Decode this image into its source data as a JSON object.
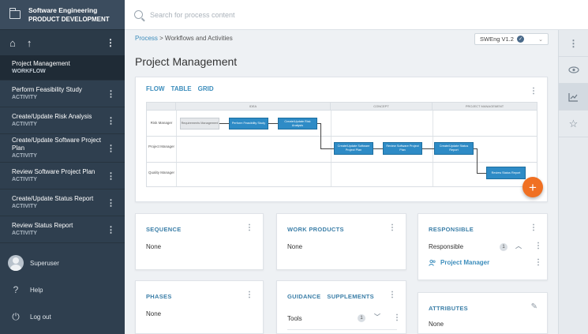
{
  "sidebar": {
    "header": {
      "line1": "Software Engineering",
      "line2": "PRODUCT DEVELOPMENT"
    },
    "current": {
      "name": "Project Management",
      "type": "WORKFLOW"
    },
    "items": [
      {
        "name": "Perform Feasibility Study",
        "type": "ACTIVITY"
      },
      {
        "name": "Create/Update Risk Analysis",
        "type": "ACTIVITY"
      },
      {
        "name": "Create/Update Software Project Plan",
        "type": "ACTIVITY"
      },
      {
        "name": "Review Software Project Plan",
        "type": "ACTIVITY"
      },
      {
        "name": "Create/Update Status Report",
        "type": "ACTIVITY"
      },
      {
        "name": "Review Status Report",
        "type": "ACTIVITY"
      }
    ],
    "user": "Superuser",
    "help": "Help",
    "logout": "Log out"
  },
  "search": {
    "placeholder": "Search for process content"
  },
  "breadcrumb": {
    "root": "Process",
    "separator": ">",
    "current": "Workflows and Activities"
  },
  "version": {
    "label": "SWEng V1.2"
  },
  "page": {
    "title": "Project Management"
  },
  "flow_card": {
    "tabs": [
      "FLOW",
      "TABLE",
      "GRID"
    ],
    "diagram": {
      "phases": [
        "IDEA",
        "CONCEPT",
        "PROJECT MANAGEMENT"
      ],
      "lanes": [
        "Risk Manager",
        "Project Manager",
        "Quality Manager"
      ],
      "nodes": [
        "Requirements Management",
        "Perform Feasibility Study",
        "Create/Update Risk Analysis",
        "Create/Update Software Project Plan",
        "Review Software Project Plan",
        "Create/Update Status Report",
        "Review Status Report"
      ]
    }
  },
  "cards": {
    "sequence": {
      "title": "SEQUENCE",
      "value": "None"
    },
    "work_products": {
      "title": "WORK PRODUCTS",
      "value": "None"
    },
    "responsible": {
      "title": "RESPONSIBLE",
      "row_label": "Responsible",
      "count": "1",
      "person": "Project Manager"
    },
    "phases": {
      "title": "PHASES",
      "value": "None"
    },
    "guidance": {
      "title": "GUIDANCE",
      "title2": "SUPPLEMENTS",
      "row_label": "Tools",
      "count": "1"
    },
    "attributes": {
      "title": "ATTRIBUTES",
      "value": "None"
    }
  },
  "icons": {
    "folder": "folder-icon",
    "home": "home-icon",
    "up": "arrow-up-icon",
    "search": "search-icon",
    "eye": "eye-icon",
    "chart": "chart-icon",
    "star": "star-icon",
    "help": "help-icon",
    "logout": "power-icon",
    "add": "plus-icon",
    "edit": "pencil-icon",
    "person": "person-icon"
  },
  "colors": {
    "sidebar": "#2f3f4f",
    "accent": "#3c8dbc",
    "node": "#2e8bc6",
    "fab": "#f07022"
  }
}
